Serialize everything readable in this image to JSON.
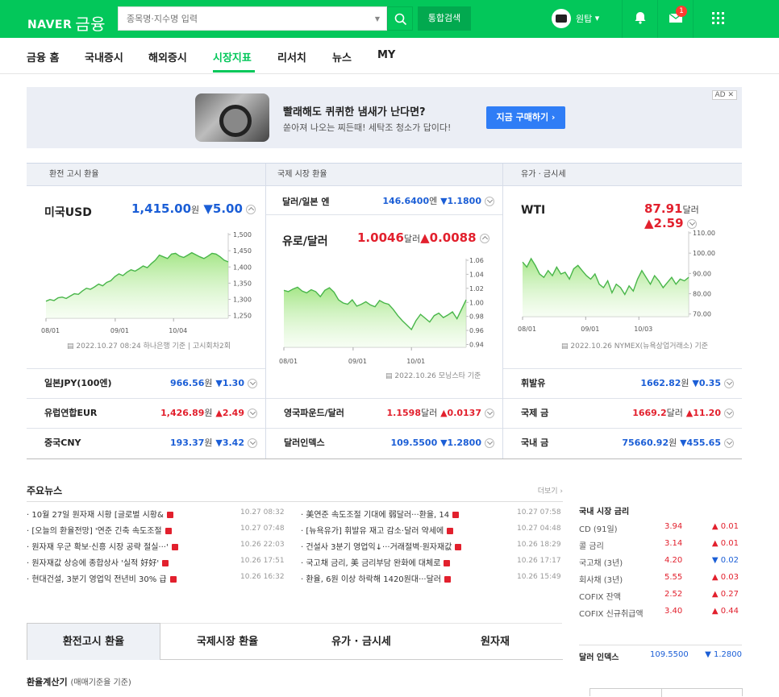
{
  "header": {
    "logo": "NAVER",
    "logo_sub": "금융",
    "search_placeholder": "종목명·지수명 입력",
    "total_search": "통합검색",
    "user": "원탑",
    "mail_badge": "1"
  },
  "nav": [
    "금융 홈",
    "국내증시",
    "해외증시",
    "시장지표",
    "리서치",
    "뉴스",
    "MY"
  ],
  "ad": {
    "title": "빨래해도 퀴퀴한 냄새가 난다면?",
    "desc": "쏟아져 나오는 찌든때! 세탁조 청소가 답이다!",
    "button": "지금 구매하기 ›",
    "badge": "AD ✕"
  },
  "sections": {
    "exchange": "환전 고시 환율",
    "intl": "국제 시장 환율",
    "oil": "유가 · 금시세"
  },
  "usd": {
    "name": "미국USD",
    "value": "1,415.00",
    "unit": "원",
    "change": "▼5.00",
    "source": "2022.10.27 08:24 하나은행 기준",
    "round": "고시회차2회"
  },
  "jpyusd": {
    "name": "달러/일본 엔",
    "value": "146.6400",
    "unit": "엔",
    "change": "▼1.1800"
  },
  "eurusd": {
    "name": "유로/달러",
    "value": "1.0046",
    "unit": "달러",
    "change": "▲0.0088",
    "source": "2022.10.26 모닝스타 기준"
  },
  "wti": {
    "name": "WTI",
    "value": "87.91",
    "unit": "달러",
    "change": "▲2.59",
    "source": "2022.10.26 NYMEX(뉴욕상업거래소) 기준"
  },
  "rows": {
    "left": [
      {
        "name": "일본JPY(100엔)",
        "value": "966.56",
        "unit": "원",
        "change": "▼1.30",
        "dir": "d"
      },
      {
        "name": "유럽연합EUR",
        "value": "1,426.89",
        "unit": "원",
        "change": "▲2.49",
        "dir": "u"
      },
      {
        "name": "중국CNY",
        "value": "193.37",
        "unit": "원",
        "change": "▼3.42",
        "dir": "d"
      }
    ],
    "mid": [
      {
        "name": "영국파운드/달러",
        "value": "1.1598",
        "unit": "달러",
        "change": "▲0.0137",
        "dir": "u"
      },
      {
        "name": "달러인덱스",
        "value": "109.5500",
        "unit": "",
        "change": "▼1.2800",
        "dir": "d"
      }
    ],
    "right": [
      {
        "name": "휘발유",
        "value": "1662.82",
        "unit": "원",
        "change": "▼0.35",
        "dir": "d"
      },
      {
        "name": "국제 금",
        "value": "1669.2",
        "unit": "달러",
        "change": "▲11.20",
        "dir": "u"
      },
      {
        "name": "국내 금",
        "value": "75660.92",
        "unit": "원",
        "change": "▼455.65",
        "dir": "d"
      }
    ]
  },
  "chart_data": [
    {
      "type": "area",
      "name": "미국USD",
      "x_ticks": [
        "08/01",
        "09/01",
        "10/04"
      ],
      "y_ticks": [
        "1,500",
        "1,450",
        "1,400",
        "1,350",
        "1,300",
        "1,250"
      ],
      "ylim": [
        1250,
        1500
      ],
      "values": [
        1300,
        1305,
        1302,
        1310,
        1312,
        1308,
        1315,
        1322,
        1320,
        1330,
        1338,
        1335,
        1342,
        1350,
        1345,
        1355,
        1360,
        1372,
        1380,
        1375,
        1385,
        1392,
        1388,
        1395,
        1403,
        1398,
        1410,
        1420,
        1435,
        1430,
        1425,
        1438,
        1440,
        1432,
        1428,
        1435,
        1442,
        1436,
        1430,
        1425,
        1432,
        1440,
        1438,
        1430,
        1420,
        1415
      ]
    },
    {
      "type": "area",
      "name": "유로/달러",
      "x_ticks": [
        "08/01",
        "09/01",
        "10/01"
      ],
      "y_ticks": [
        "1.06",
        "1.04",
        "1.02",
        "1.00",
        "0.98",
        "0.96",
        "0.94"
      ],
      "ylim": [
        0.93,
        1.07
      ],
      "values": [
        1.02,
        1.018,
        1.022,
        1.025,
        1.019,
        1.016,
        1.021,
        1.018,
        1.01,
        1.02,
        1.024,
        1.017,
        1.005,
        1.0,
        0.998,
        1.005,
        0.995,
        0.998,
        1.002,
        0.997,
        0.994,
        1.004,
        1.0,
        0.998,
        0.99,
        0.98,
        0.972,
        0.965,
        0.958,
        0.972,
        0.982,
        0.976,
        0.97,
        0.98,
        0.984,
        0.977,
        0.981,
        0.986,
        0.975,
        0.99,
        1.005
      ]
    },
    {
      "type": "area",
      "name": "WTI",
      "x_ticks": [
        "08/01",
        "09/01",
        "10/03"
      ],
      "y_ticks": [
        "110.00",
        "100.00",
        "90.00",
        "80.00",
        "70.00"
      ],
      "ylim": [
        65,
        115
      ],
      "values": [
        97,
        94,
        99,
        95,
        90,
        88,
        92,
        89,
        94,
        90,
        91,
        87,
        93,
        95,
        92,
        89,
        87,
        90,
        84,
        82,
        86,
        79,
        84,
        82,
        78,
        83,
        80,
        87,
        92,
        88,
        84,
        89,
        86,
        82,
        85,
        88,
        84,
        87,
        86,
        88
      ]
    }
  ],
  "news": {
    "title": "주요뉴스",
    "more": "더보기 ›",
    "items": [
      {
        "t": "10월 27일 원자재 시황 [글로벌 시황&",
        "d": "10.27 08:32"
      },
      {
        "t": "[오늘의 환율전망] '연준 긴축 속도조절",
        "d": "10.27 07:48"
      },
      {
        "t": "원자재 우군 확보·신흥 시장 공략 절실···'",
        "d": "10.26 22:03"
      },
      {
        "t": "원자재값 상승에 종합상사 '실적 好好'",
        "d": "10.26 17:51"
      },
      {
        "t": "현대건설, 3분기 영업익 전년비 30% 급",
        "d": "10.26 16:32"
      },
      {
        "t": "美연준 속도조절 기대에 弱달러···환율, 14",
        "d": "10.27 07:58"
      },
      {
        "t": "[뉴욕유가] 휘발유 재고 감소·달러 약세에",
        "d": "10.27 04:48"
      },
      {
        "t": "건설사 3분기 영업익↓···거래절벽·원자재값",
        "d": "10.26 18:29"
      },
      {
        "t": "국고채 금리, 美 금리부담 완화에 대체로",
        "d": "10.26 17:17"
      },
      {
        "t": "환율, 6원 이상 하락해 1420원대···달러",
        "d": "10.26 15:49"
      }
    ]
  },
  "rates": {
    "title": "국내 시장 금리",
    "items": [
      {
        "n": "CD (91일)",
        "v": "3.94",
        "c": "▲ 0.01",
        "dir": "u"
      },
      {
        "n": "콜 금리",
        "v": "3.14",
        "c": "▲ 0.01",
        "dir": "u"
      },
      {
        "n": "국고채 (3년)",
        "v": "4.20",
        "c": "▼ 0.02",
        "dir": "d"
      },
      {
        "n": "회사채 (3년)",
        "v": "5.55",
        "c": "▲ 0.03",
        "dir": "u"
      },
      {
        "n": "COFIX 잔액",
        "v": "2.52",
        "c": "▲ 0.27",
        "dir": "u"
      },
      {
        "n": "COFIX 신규취급액",
        "v": "3.40",
        "c": "▲ 0.44",
        "dir": "u"
      }
    ]
  },
  "dollar_index": {
    "n": "달러 인덱스",
    "v": "109.5500",
    "c": "▼ 1.2800"
  },
  "tabs": [
    "환전고시 환율",
    "국제시장 환율",
    "유가 · 금시세",
    "원자재"
  ],
  "calc": {
    "title": "환율계산기",
    "sub": "(매매기준율 기준)"
  }
}
